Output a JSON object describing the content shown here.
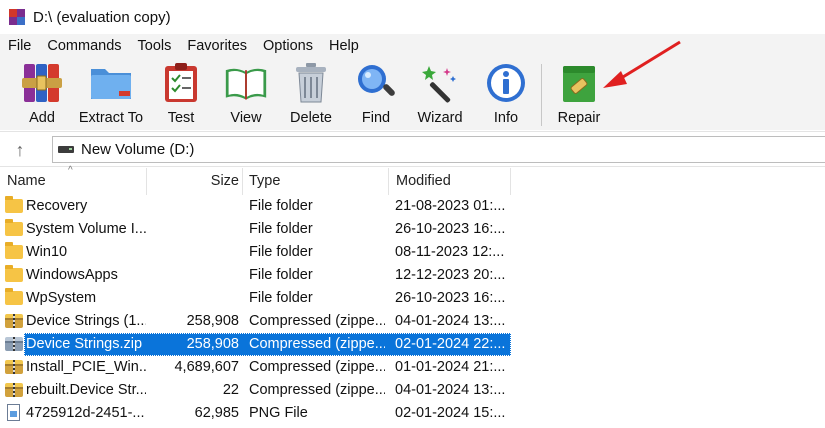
{
  "window": {
    "title": "D:\\ (evaluation copy)"
  },
  "menu": [
    "File",
    "Commands",
    "Tools",
    "Favorites",
    "Options",
    "Help"
  ],
  "toolbar": {
    "add": "Add",
    "extract": "Extract To",
    "test": "Test",
    "view": "View",
    "delete": "Delete",
    "find": "Find",
    "wizard": "Wizard",
    "info": "Info",
    "repair": "Repair"
  },
  "address": {
    "path": "New Volume (D:)"
  },
  "columns": {
    "name": "Name",
    "size": "Size",
    "type": "Type",
    "modified": "Modified"
  },
  "files": [
    {
      "icon": "folder-icon",
      "name": "Recovery",
      "size": "",
      "type": "File folder",
      "modified": "21-08-2023 01:..."
    },
    {
      "icon": "folder-icon",
      "name": "System Volume I...",
      "size": "",
      "type": "File folder",
      "modified": "26-10-2023 16:..."
    },
    {
      "icon": "folder-icon",
      "name": "Win10",
      "size": "",
      "type": "File folder",
      "modified": "08-11-2023 12:..."
    },
    {
      "icon": "folder-icon",
      "name": "WindowsApps",
      "size": "",
      "type": "File folder",
      "modified": "12-12-2023 20:..."
    },
    {
      "icon": "folder-icon",
      "name": "WpSystem",
      "size": "",
      "type": "File folder",
      "modified": "26-10-2023 16:..."
    },
    {
      "icon": "zip-icon",
      "name": "Device Strings (1...",
      "size": "258,908",
      "type": "Compressed (zippe...",
      "modified": "04-01-2024 13:..."
    },
    {
      "icon": "zip-icon",
      "name": "Device Strings.zip",
      "size": "258,908",
      "type": "Compressed (zippe...",
      "modified": "02-01-2024 22:..."
    },
    {
      "icon": "zip-icon",
      "name": "Install_PCIE_Win...",
      "size": "4,689,607",
      "type": "Compressed (zippe...",
      "modified": "01-01-2024 21:..."
    },
    {
      "icon": "zip-icon",
      "name": "rebuilt.Device Str...",
      "size": "22",
      "type": "Compressed (zippe...",
      "modified": "04-01-2024 13:..."
    },
    {
      "icon": "png-file-icon",
      "name": "4725912d-2451-...",
      "size": "62,985",
      "type": "PNG File",
      "modified": "02-01-2024 15:..."
    }
  ],
  "selected_row": 6,
  "colors": {
    "selection": "#0a74da",
    "annotation_arrow": "#e02020",
    "toolbar_bg": "#f3f3f3"
  }
}
